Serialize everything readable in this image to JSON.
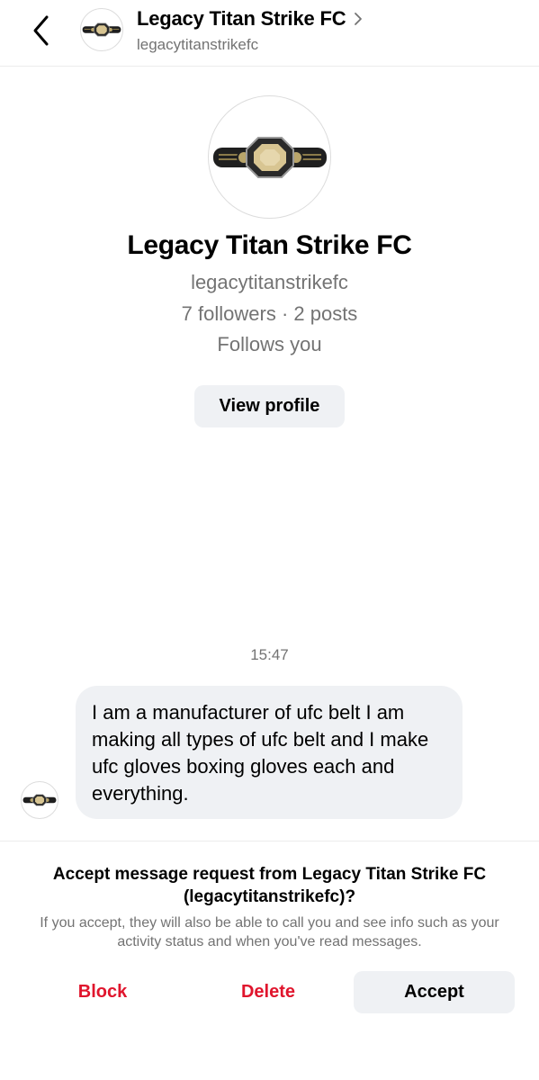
{
  "header": {
    "title": "Legacy Titan Strike FC",
    "handle": "legacytitanstrikefc",
    "back_icon": "chevron-left-icon",
    "chevron_icon": "chevron-right-icon"
  },
  "profile": {
    "name": "Legacy Titan Strike FC",
    "handle": "legacytitanstrikefc",
    "stats": "7 followers · 2 posts",
    "follows_you": "Follows you",
    "view_profile_label": "View profile",
    "avatar_image": "championship-belt"
  },
  "conversation": {
    "timestamp": "15:47",
    "messages": [
      {
        "text": "I am a manufacturer of ufc belt I am making all types of ufc belt and I make ufc gloves boxing gloves each and everything."
      }
    ]
  },
  "request": {
    "title": "Accept message request from Legacy Titan Strike FC (legacytitanstrikefc)?",
    "info": "If you accept, they will also be able to call you and see info such as your activity status and when you've read messages.",
    "block_label": "Block",
    "delete_label": "Delete",
    "accept_label": "Accept"
  },
  "colors": {
    "destructive": "#e0152d",
    "secondary_text": "#737373",
    "bubble_bg": "#eff1f4"
  }
}
